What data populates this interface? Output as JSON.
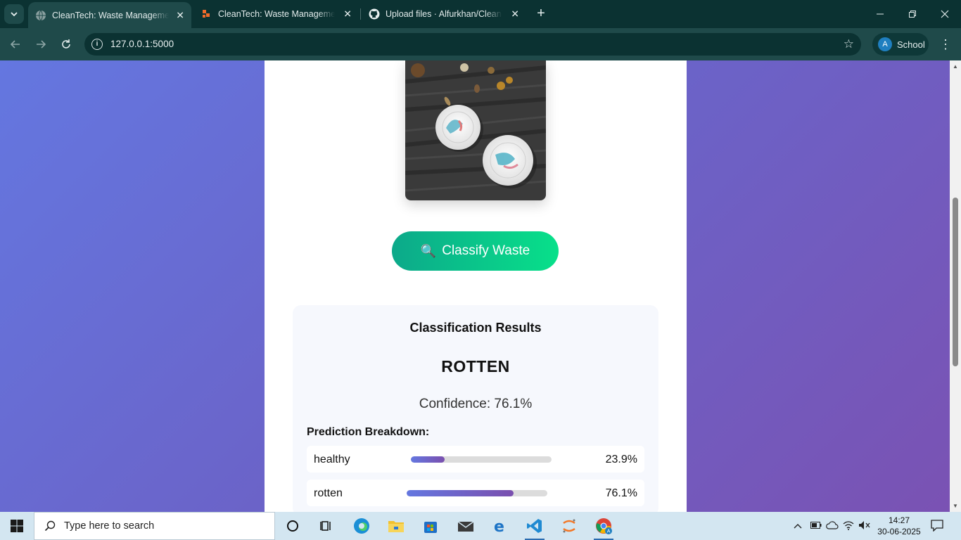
{
  "browser": {
    "tabs": [
      {
        "title": "CleanTech: Waste Management",
        "active": true
      },
      {
        "title": "CleanTech: Waste Management",
        "active": false
      },
      {
        "title": "Upload files · Alfurkhan/CleanTe",
        "active": false
      }
    ],
    "url": "127.0.0.1:5000",
    "profile": {
      "initial": "A",
      "name": "School"
    }
  },
  "page": {
    "classify_button": "Classify Waste",
    "results": {
      "heading": "Classification Results",
      "label": "ROTTEN",
      "confidence": "Confidence: 76.1%",
      "breakdown_title": "Prediction Breakdown:",
      "rows": [
        {
          "name": "healthy",
          "percent": "23.9%",
          "value": 0.239
        },
        {
          "name": "rotten",
          "percent": "76.1%",
          "value": 0.761
        }
      ]
    }
  },
  "taskbar": {
    "search_placeholder": "Type here to search",
    "time": "14:27",
    "date": "30-06-2025"
  },
  "colors": {
    "accent_gradient_start": "#0ca98a",
    "accent_gradient_end": "#08e08a",
    "bar_fill_start": "#6477e0",
    "bar_fill_end": "#7a4fae"
  }
}
